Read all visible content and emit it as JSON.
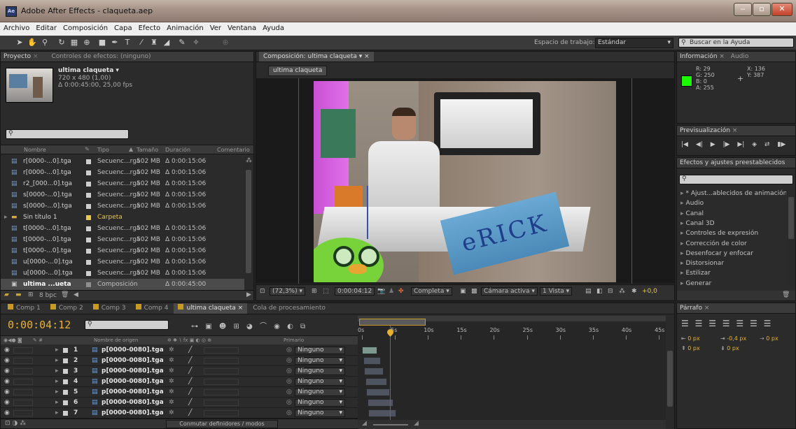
{
  "window": {
    "title": "Adobe After Effects - claqueta.aep",
    "app_icon": "Ae"
  },
  "menu": [
    "Archivo",
    "Editar",
    "Composición",
    "Capa",
    "Efecto",
    "Animación",
    "Ver",
    "Ventana",
    "Ayuda"
  ],
  "toolbar": {
    "workspace_label": "Espacio de trabajo:",
    "workspace_value": "Estándar",
    "help_search_placeholder": "Buscar en la Ayuda"
  },
  "project": {
    "tabs": [
      "Proyecto",
      "Controles de efectos: (ninguno)"
    ],
    "comp_name": "ultima claqueta ▾",
    "comp_size": "720 x 480 (1,00)",
    "comp_duration": "Δ 0:00:45:00, 25,00 fps",
    "columns": [
      "Nombre",
      "Tipo",
      "Tamaño",
      "Duración",
      "Comentario"
    ],
    "items": [
      {
        "name": "r[0000-...0].tga",
        "type": "Secuenc...rga",
        "size": "502 MB",
        "duration": "Δ 0:00:15:06",
        "color": "#cfcfcf"
      },
      {
        "name": "r[0000-...0].tga",
        "type": "Secuenc...rga",
        "size": "502 MB",
        "duration": "Δ 0:00:15:06",
        "color": "#cfcfcf"
      },
      {
        "name": "r2_[000...0].tga",
        "type": "Secuenc...rga",
        "size": "502 MB",
        "duration": "Δ 0:00:15:06",
        "color": "#cfcfcf"
      },
      {
        "name": "s[0000-...0].tga",
        "type": "Secuenc...rga",
        "size": "502 MB",
        "duration": "Δ 0:00:15:06",
        "color": "#cfcfcf"
      },
      {
        "name": "s[0000-...0].tga",
        "type": "Secuenc...rga",
        "size": "502 MB",
        "duration": "Δ 0:00:15:06",
        "color": "#cfcfcf"
      },
      {
        "name": "Sin título 1",
        "type": "Carpeta",
        "size": "",
        "duration": "",
        "color": "#e8c94c"
      },
      {
        "name": "t[0000-...0].tga",
        "type": "Secuenc...rga",
        "size": "502 MB",
        "duration": "Δ 0:00:15:06",
        "color": "#cfcfcf"
      },
      {
        "name": "t[0000-...0].tga",
        "type": "Secuenc...rga",
        "size": "502 MB",
        "duration": "Δ 0:00:15:06",
        "color": "#cfcfcf"
      },
      {
        "name": "t[0000-...0].tga",
        "type": "Secuenc...rga",
        "size": "502 MB",
        "duration": "Δ 0:00:15:06",
        "color": "#cfcfcf"
      },
      {
        "name": "u[0000-...0].tga",
        "type": "Secuenc...rga",
        "size": "502 MB",
        "duration": "Δ 0:00:15:06",
        "color": "#cfcfcf"
      },
      {
        "name": "u[0000-...0].tga",
        "type": "Secuenc...rga",
        "size": "502 MB",
        "duration": "Δ 0:00:15:06",
        "color": "#cfcfcf"
      },
      {
        "name": "ultima ...ueta",
        "type": "Composición",
        "size": "",
        "duration": "Δ 0:00:45:00",
        "color": "#8f8f8f"
      }
    ],
    "bpc": "8 bpc"
  },
  "composition": {
    "tab": "Composición: ultima claqueta",
    "sub_tab": "ultima claqueta",
    "zoom": "(72,3%)",
    "timecode": "0:00:04:12",
    "resolution": "Completa",
    "camera": "Cámara activa",
    "views": "1 Vista",
    "exposure": "+0,0",
    "sign_text": "eRICK"
  },
  "info": {
    "tabs": [
      "Información",
      "Audio"
    ],
    "r": "R: 29",
    "g": "G: 250",
    "b": "B: 0",
    "a": "A: 255",
    "x": "X: 136",
    "y": "Y: 387",
    "color": "#1dfa00"
  },
  "preview": {
    "tab": "Previsualización"
  },
  "effects": {
    "tab": "Efectos y ajustes preestablecidos",
    "items": [
      "* Ajust...ablecidos de animación",
      "Audio",
      "Canal",
      "Canal 3D",
      "Controles de expresión",
      "Corrección de color",
      "Desenfocar y enfocar",
      "Distorsionar",
      "Estilizar",
      "Generar"
    ]
  },
  "paragraph": {
    "tab": "Párrafo",
    "values": [
      "0 px",
      "-0,4 px",
      "0 px",
      "0 px",
      "0 px"
    ]
  },
  "timeline": {
    "tabs": [
      "Comp 1",
      "Comp 2",
      "Comp 3",
      "Comp 4",
      "ultima claqueta",
      "Cola de procesamiento"
    ],
    "timecode": "0:00:04:12",
    "col_source": "Nombre de origen",
    "col_parent": "Primario",
    "ruler": [
      "0s",
      "5s",
      "10s",
      "15s",
      "20s",
      "25s",
      "30s",
      "35s",
      "40s",
      "45s"
    ],
    "layers": [
      {
        "num": "1",
        "name": "p[0000-0080].tga",
        "parent": "Ninguno"
      },
      {
        "num": "2",
        "name": "p[0000-0080].tga",
        "parent": "Ninguno"
      },
      {
        "num": "3",
        "name": "p[0000-0080].tga",
        "parent": "Ninguno"
      },
      {
        "num": "4",
        "name": "p[0000-0080].tga",
        "parent": "Ninguno"
      },
      {
        "num": "5",
        "name": "p[0000-0080].tga",
        "parent": "Ninguno"
      },
      {
        "num": "6",
        "name": "p[0000-0080].tga",
        "parent": "Ninguno"
      },
      {
        "num": "7",
        "name": "p[0000-0080].tga",
        "parent": "Ninguno"
      }
    ],
    "toggle_label": "Conmutar definidores / modos"
  }
}
